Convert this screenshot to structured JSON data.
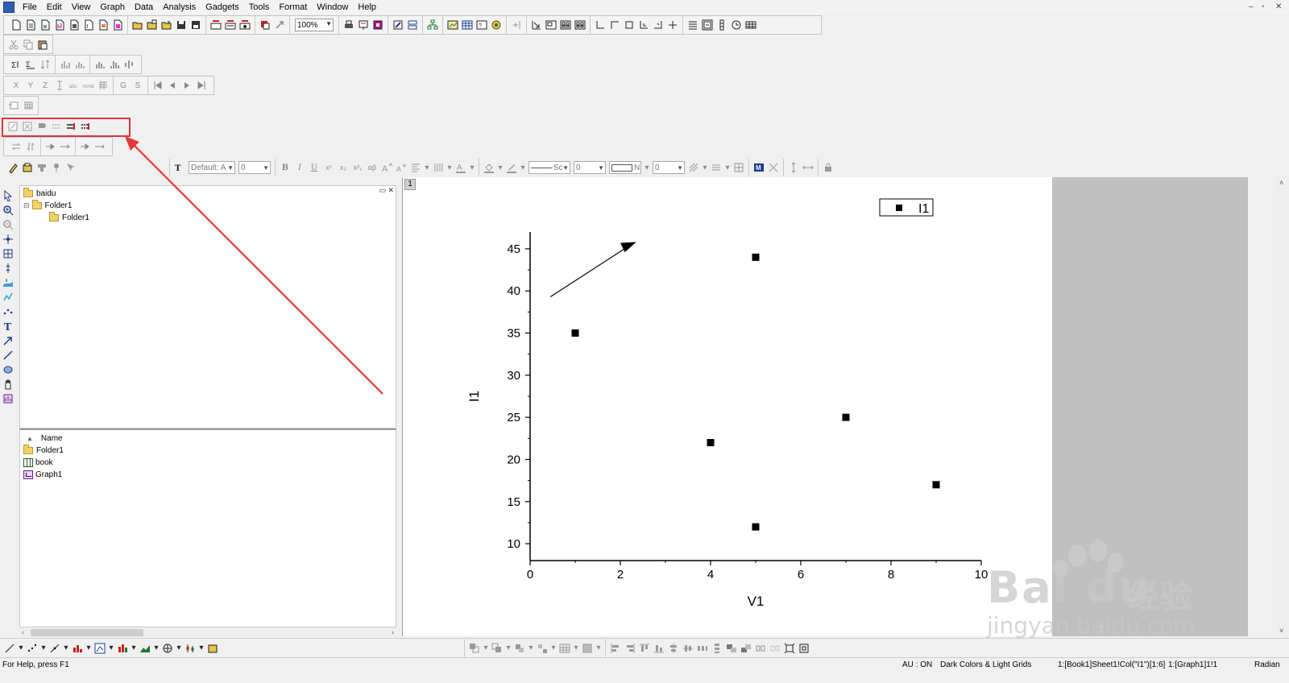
{
  "menu": {
    "items": [
      "File",
      "Edit",
      "View",
      "Graph",
      "Data",
      "Analysis",
      "Gadgets",
      "Tools",
      "Format",
      "Window",
      "Help"
    ]
  },
  "window_controls": [
    "–",
    "▫",
    "✕"
  ],
  "standard_toolbar": {
    "zoom_value": "100%"
  },
  "format_toolbar": {
    "font_name": "Default: A",
    "font_size": "0",
    "bold": "B",
    "italic": "I",
    "underline": "U",
    "superscript": "x²",
    "subscript": "x₂",
    "super_sub": "x²₁",
    "greek": "αβ",
    "line_style": "Sc",
    "line_width": "0",
    "fill_pattern": "N",
    "pattern_width": "0"
  },
  "worksheet_toolbar": {
    "x": "X",
    "y": "Y",
    "z": "Z",
    "g": "G",
    "s": "S"
  },
  "project_tree": {
    "root": "baidu",
    "children": [
      {
        "name": "Folder1",
        "children": [
          {
            "name": "Folder1"
          }
        ]
      }
    ]
  },
  "file_list": {
    "column_header": "Name",
    "items": [
      {
        "name": "Folder1",
        "type": "folder"
      },
      {
        "name": "book",
        "type": "book"
      },
      {
        "name": "Graph1",
        "type": "graph"
      }
    ]
  },
  "graph": {
    "layer_label": "1",
    "legend_label": "I1"
  },
  "chart_data": {
    "type": "scatter",
    "series": [
      {
        "name": "I1",
        "x": [
          1,
          4,
          5,
          5,
          7,
          9
        ],
        "y": [
          35,
          22,
          44,
          12,
          25,
          17
        ]
      }
    ],
    "xlabel": "V1",
    "ylabel": "I1",
    "xlim": [
      0,
      10
    ],
    "ylim": [
      8,
      47
    ],
    "x_ticks": [
      "0",
      "2",
      "4",
      "6",
      "8",
      "10"
    ],
    "y_ticks": [
      "10",
      "15",
      "20",
      "25",
      "30",
      "35",
      "40",
      "45"
    ],
    "grid": false,
    "legend_position": "top-right",
    "annotation": "arrow"
  },
  "status": {
    "help": "For Help, press F1",
    "au": "AU : ON",
    "theme": "Dark Colors & Light Grids",
    "col": "1:[Book1]Sheet1!Col(\"I1\")[1:6]",
    "graph": "1:[Graph1]1!1",
    "angle": "Radian"
  },
  "watermark": {
    "logo": "Bai du",
    "site": "jingyan.baidu.com",
    "cn": "经验"
  },
  "colors": {
    "highlight": "#d9363e",
    "arrow": "#e03a3a",
    "folder": "#f2d36b"
  }
}
